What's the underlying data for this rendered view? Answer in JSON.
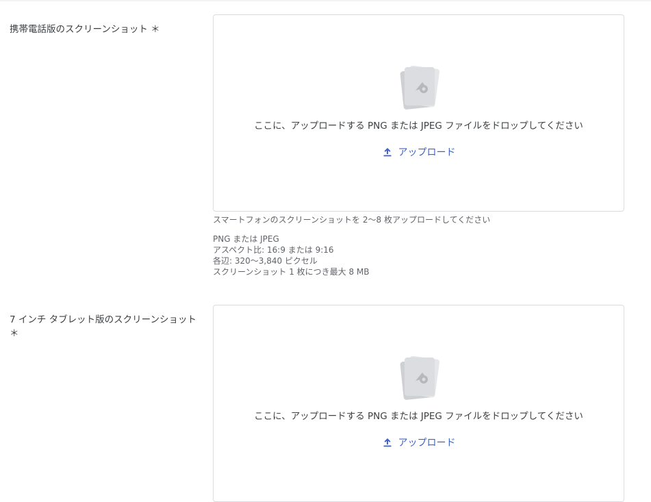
{
  "phone": {
    "label": "携帯電話版のスクリーンショット ＊",
    "drop_text": "ここに、アップロードする PNG または JPEG ファイルをドロップしてください",
    "upload_label": "アップロード",
    "help_lead": "スマートフォンのスクリーンショットを 2〜8 枚アップロードしてください",
    "requirements": [
      "PNG または JPEG",
      "アスペクト比: 16:9 または 9:16",
      "各辺: 320〜3,840 ピクセル",
      "スクリーンショット 1 枚につき最大 8 MB"
    ]
  },
  "tablet7": {
    "label": "7 インチ タブレット版のスクリーンショット ＊",
    "drop_text": "ここに、アップロードする PNG または JPEG ファイルをドロップしてください",
    "upload_label": "アップロード"
  },
  "icons": {
    "file": "image-file-icon",
    "upload": "upload-icon"
  },
  "colors": {
    "accent": "#3f62c8",
    "border": "#dadce0",
    "text": "#3c4043",
    "muted": "#5f6368"
  }
}
